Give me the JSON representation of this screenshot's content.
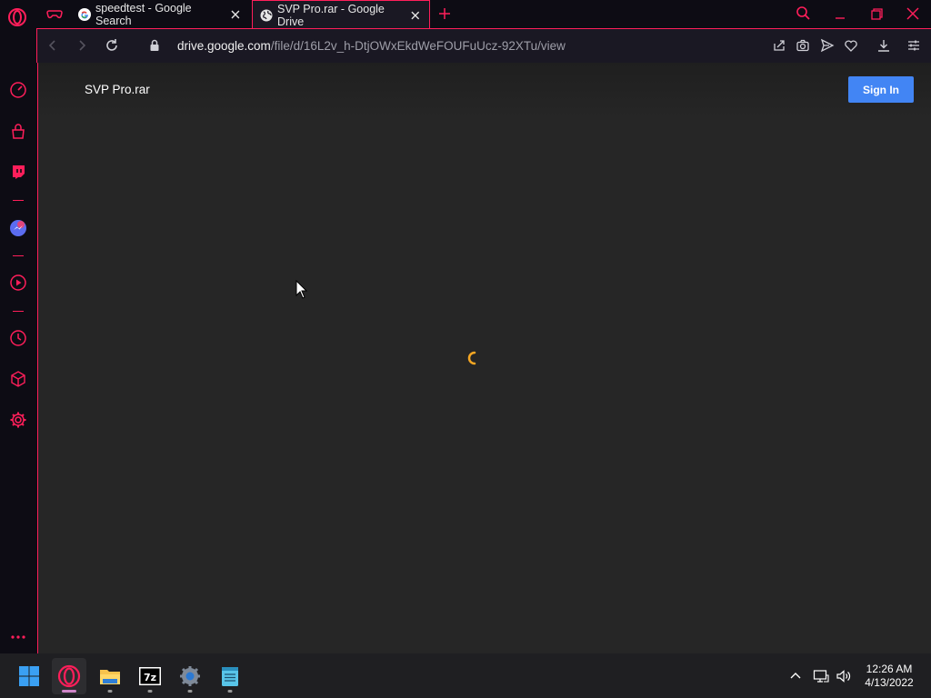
{
  "browser": {
    "tabs": [
      {
        "title": "speedtest - Google Search",
        "favicon": "google-g-icon",
        "active": false
      },
      {
        "title": "SVP Pro.rar - Google Drive",
        "favicon": "globe-icon",
        "active": true
      }
    ],
    "address": {
      "prefix": "",
      "host": "drive.google.com",
      "path": "/file/d/16L2v_h-DtjOWxEkdWeFOUFuUcz-92XTu/view"
    },
    "accent_color": "#ff1e5a"
  },
  "page": {
    "file_title": "SVP Pro.rar",
    "sign_in_label": "Sign In",
    "button_color": "#4285f4"
  },
  "taskbar": {
    "apps": [
      "windows-start",
      "opera-gx",
      "file-explorer",
      "7-zip",
      "settings",
      "notepad"
    ],
    "time": "12:26 AM",
    "date": "4/13/2022"
  }
}
